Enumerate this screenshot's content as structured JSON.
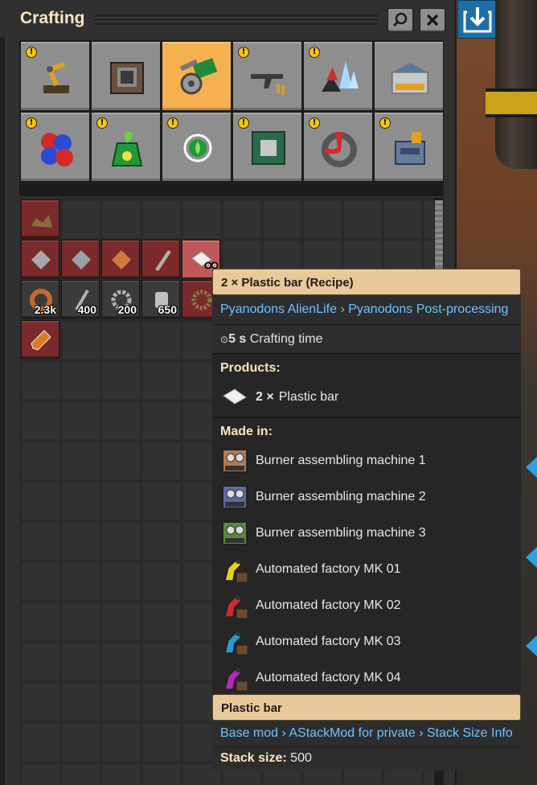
{
  "window": {
    "title": "Crafting",
    "search_icon": "magnifier-icon",
    "close_icon": "close-icon"
  },
  "external_button": {
    "icon": "import-arrow-icon"
  },
  "item_groups": [
    {
      "name": "logistics",
      "warning": "!",
      "selected": false
    },
    {
      "name": "production",
      "warning": "",
      "selected": false
    },
    {
      "name": "intermediate-products",
      "warning": "",
      "selected": true
    },
    {
      "name": "combat",
      "warning": "!",
      "selected": false
    },
    {
      "name": "py-resources",
      "warning": "!",
      "selected": false
    },
    {
      "name": "py-buildings",
      "warning": "",
      "selected": false
    },
    {
      "name": "chemistry",
      "warning": "!",
      "selected": false
    },
    {
      "name": "py-alien-life",
      "warning": "!",
      "selected": false
    },
    {
      "name": "py-bio",
      "warning": "!",
      "selected": false
    },
    {
      "name": "py-high-tech",
      "warning": "!",
      "selected": false
    },
    {
      "name": "py-petroleum",
      "warning": "!",
      "selected": false
    },
    {
      "name": "py-industry",
      "warning": "!",
      "selected": false
    }
  ],
  "recipe_slots": [
    {
      "name": "ore-chunks",
      "count": "",
      "style": "red"
    },
    {
      "name": "steel-plate",
      "count": "",
      "style": "red"
    },
    {
      "name": "iron-plate",
      "count": "",
      "style": "red"
    },
    {
      "name": "copper-plate",
      "count": "",
      "style": "red"
    },
    {
      "name": "steel-beam",
      "count": "",
      "style": "red"
    },
    {
      "name": "plastic-bar",
      "count": "",
      "style": "hover"
    },
    {
      "name": "copper-coil",
      "count": "2.3k",
      "style": "grey"
    },
    {
      "name": "iron-stick",
      "count": "400",
      "style": "grey"
    },
    {
      "name": "iron-gear",
      "count": "200",
      "style": "grey"
    },
    {
      "name": "tin-can",
      "count": "650",
      "style": "grey"
    },
    {
      "name": "engine-part",
      "count": "",
      "style": "red"
    },
    {
      "name": "test-tube",
      "count": "",
      "style": "red"
    }
  ],
  "tooltip": {
    "recipe_title": "2 × Plastic bar (Recipe)",
    "recipe_mods": "Pyanodons AlienLife › Pyanodons Post-processing",
    "crafting_time_value": "5 s",
    "crafting_time_label": "Crafting time",
    "products_title": "Products:",
    "product_amount": "2 ×",
    "product_name": "Plastic bar",
    "made_in_title": "Made in:",
    "made_in": [
      {
        "label": "Burner assembling machine 1",
        "icon": "burner-assembler-1-icon",
        "color": "#b07a50"
      },
      {
        "label": "Burner assembling machine 2",
        "icon": "burner-assembler-2-icon",
        "color": "#5a6aa0"
      },
      {
        "label": "Burner assembling machine 3",
        "icon": "burner-assembler-3-icon",
        "color": "#5a8a3a"
      },
      {
        "label": "Automated factory MK 01",
        "icon": "automated-factory-mk01-icon",
        "color": "#e8d21a"
      },
      {
        "label": "Automated factory MK 02",
        "icon": "automated-factory-mk02-icon",
        "color": "#d42a2a"
      },
      {
        "label": "Automated factory MK 03",
        "icon": "automated-factory-mk03-icon",
        "color": "#2a9ad4"
      },
      {
        "label": "Automated factory MK 04",
        "icon": "automated-factory-mk04-icon",
        "color": "#b42ab4"
      }
    ],
    "item_title": "Plastic bar",
    "item_mods": "Base mod › AStackMod for private › Stack Size Info",
    "stack_size_label": "Stack size:",
    "stack_size_value": "500"
  }
}
